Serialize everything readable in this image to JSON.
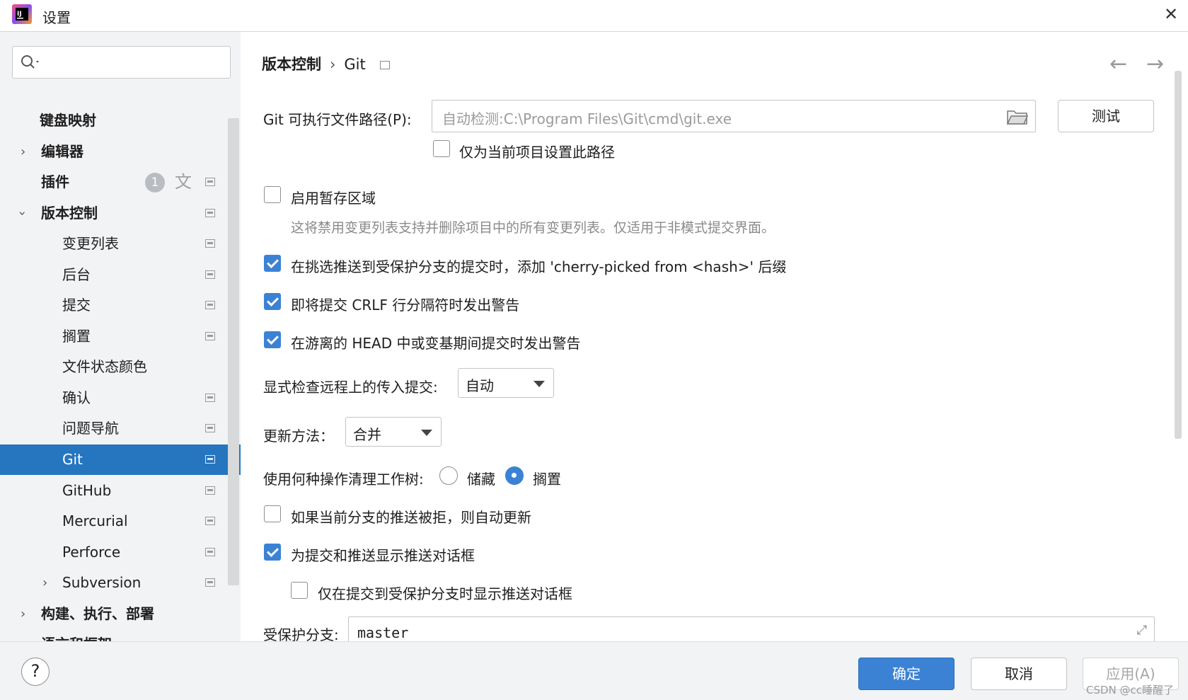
{
  "window": {
    "title": "设置",
    "close_glyph": "✕"
  },
  "sidebar": {
    "search_placeholder": "",
    "items": [
      {
        "label": "键盘映射"
      },
      {
        "label": "编辑器"
      },
      {
        "label": "插件",
        "badge": "1"
      },
      {
        "label": "版本控制"
      },
      {
        "label": "变更列表"
      },
      {
        "label": "后台"
      },
      {
        "label": "提交"
      },
      {
        "label": "搁置"
      },
      {
        "label": "文件状态颜色"
      },
      {
        "label": "确认"
      },
      {
        "label": "问题导航"
      },
      {
        "label": "Git"
      },
      {
        "label": "GitHub"
      },
      {
        "label": "Mercurial"
      },
      {
        "label": "Perforce"
      },
      {
        "label": "Subversion"
      },
      {
        "label": "构建、执行、部署"
      },
      {
        "label": "语言和框架"
      }
    ]
  },
  "breadcrumb": {
    "parent": "版本控制",
    "current": "Git"
  },
  "settings": {
    "git_path_label": "Git 可执行文件路径(P):",
    "git_path_placeholder": "自动检测:C:\\Program Files\\Git\\cmd\\git.exe",
    "test_button": "测试",
    "project_only": "仅为当前项目设置此路径",
    "staging_area": "启用暂存区域",
    "staging_hint": "这将禁用变更列表支持并删除项目中的所有变更列表。仅适用于非模式提交界面。",
    "cherry_pick": "在挑选推送到受保护分支的提交时，添加 'cherry-picked from <hash>' 后缀",
    "crlf_warn": "即将提交 CRLF 行分隔符时发出警告",
    "detached_warn": "在游离的 HEAD 中或变基期间提交时发出警告",
    "incoming_label": "显式检查远程上的传入提交:",
    "incoming_value": "自动",
    "update_method_label": "更新方法：",
    "update_method_value": "合并",
    "clean_label": "使用何种操作清理工作树:",
    "clean_stash": "储藏",
    "clean_shelve": "搁置",
    "auto_update": "如果当前分支的推送被拒，则自动更新",
    "push_dialog": "为提交和推送显示推送对话框",
    "push_dialog_protected": "仅在提交到受保护分支时显示推送对话框",
    "protected_label": "受保护分支:",
    "protected_value": "master"
  },
  "footer": {
    "help": "?",
    "ok": "确定",
    "cancel": "取消",
    "apply": "应用(A)",
    "watermark": "CSDN @cc睡醒了"
  }
}
